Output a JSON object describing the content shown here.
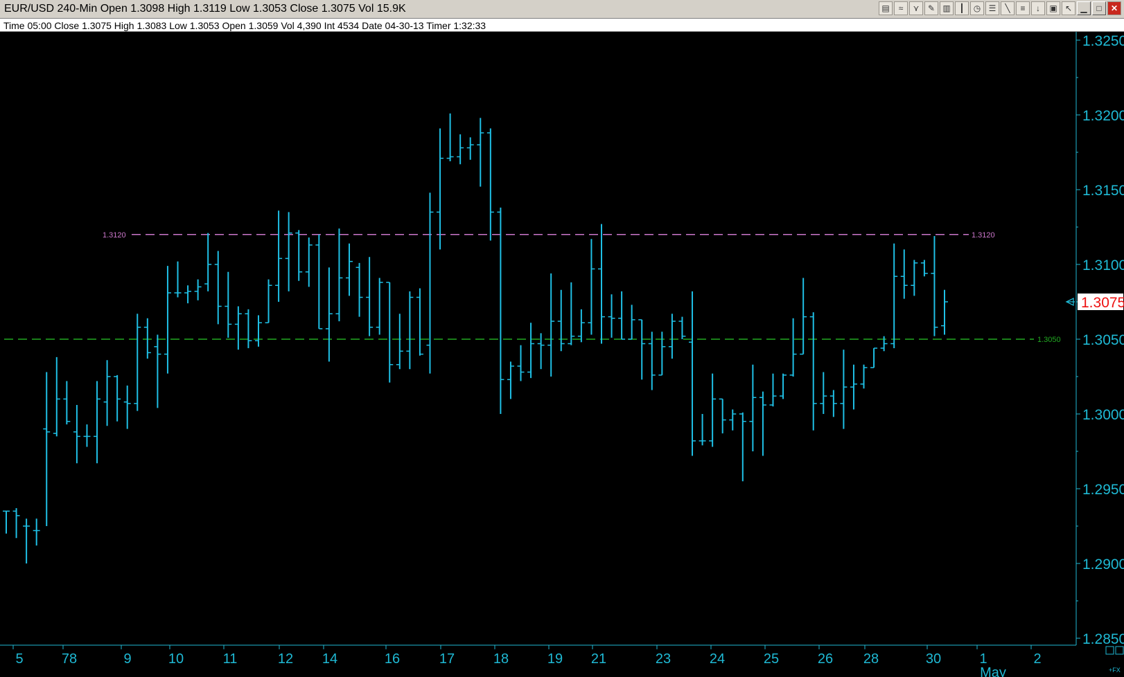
{
  "window": {
    "title": "EUR/USD 240-Min  Open 1.3098  High 1.3119  Low 1.3053  Close 1.3075  Vol 15.9K",
    "toolbar_icons": [
      "bar-chart-icon",
      "moving-average-icon",
      "indicator-icon",
      "pencil-icon",
      "histogram-icon",
      "candlestick-icon",
      "clock-icon",
      "properties-icon",
      "trendline-icon",
      "fibonacci-icon",
      "sell-arrow-icon",
      "delete-icon",
      "pointer-icon"
    ],
    "window_buttons": {
      "minimize": "▁",
      "maximize": "□",
      "close": "✕"
    }
  },
  "info_bar": {
    "text": "Time 05:00   Close 1.3075   High 1.3083   Low 1.3053   Open 1.3059   Vol 4,390   Int 4534   Date 04-30-13   Timer 1:32:33"
  },
  "colors": {
    "background": "#000000",
    "bars": "#1fc0e6",
    "axis": "#1fb9d4",
    "resistance": "#cc77cc",
    "support": "#22aa22",
    "last_price_box": "#ffffff",
    "last_price_text": "#ee1111"
  },
  "chart_data": {
    "type": "ohlc",
    "symbol": "EUR/USD",
    "ylim": [
      1.285,
      1.325
    ],
    "y_ticks": [
      "1.3250",
      "1.3200",
      "1.3150",
      "1.3100",
      "1.3050",
      "1.3000",
      "1.2950",
      "1.2900",
      "1.2850"
    ],
    "x_ticks": [
      "5",
      "78",
      "9",
      "10",
      "11",
      "12",
      "14",
      "16",
      "17",
      "18",
      "19",
      "21",
      "23",
      "24",
      "25",
      "26",
      "28",
      "30",
      "1",
      "2"
    ],
    "x_month_label": "May",
    "horizontal_lines": [
      {
        "name": "resistance",
        "value": 1.312,
        "label": "1.3120"
      },
      {
        "name": "support",
        "value": 1.305,
        "label": "1.3050"
      }
    ],
    "last_price": "1.3075",
    "corner_label": "+FX",
    "bars": [
      [
        1.2935,
        1.2935,
        1.292,
        1.2935
      ],
      [
        1.2935,
        1.2937,
        1.2917,
        1.2932
      ],
      [
        1.2925,
        1.293,
        1.29,
        1.2925
      ],
      [
        1.2922,
        1.293,
        1.2912,
        1.2922
      ],
      [
        1.299,
        1.3028,
        1.2925,
        1.2988
      ],
      [
        1.2987,
        1.3038,
        1.2985,
        1.301
      ],
      [
        1.301,
        1.3022,
        1.2993,
        1.2995
      ],
      [
        1.2988,
        1.3006,
        1.2967,
        1.2985
      ],
      [
        1.2985,
        1.2993,
        1.2978,
        1.2985
      ],
      [
        1.2985,
        1.3022,
        1.2967,
        1.301
      ],
      [
        1.3008,
        1.3036,
        1.2992,
        1.3025
      ],
      [
        1.3025,
        1.3026,
        1.2995,
        1.301
      ],
      [
        1.3008,
        1.3019,
        1.299,
        1.3007
      ],
      [
        1.3007,
        1.3067,
        1.3002,
        1.3058
      ],
      [
        1.3058,
        1.3064,
        1.3037,
        1.3041
      ],
      [
        1.3045,
        1.3053,
        1.3004,
        1.304
      ],
      [
        1.304,
        1.3099,
        1.3027,
        1.3081
      ],
      [
        1.3081,
        1.3102,
        1.3078,
        1.3081
      ],
      [
        1.3081,
        1.3086,
        1.3074,
        1.3082
      ],
      [
        1.3082,
        1.309,
        1.3076,
        1.3085
      ],
      [
        1.3087,
        1.3121,
        1.3082,
        1.31
      ],
      [
        1.31,
        1.3109,
        1.306,
        1.3072
      ],
      [
        1.3072,
        1.3095,
        1.3051,
        1.306
      ],
      [
        1.306,
        1.3072,
        1.3043,
        1.3067
      ],
      [
        1.3067,
        1.307,
        1.3044,
        1.3049
      ],
      [
        1.3049,
        1.3066,
        1.3045,
        1.3061
      ],
      [
        1.3061,
        1.309,
        1.3062,
        1.3086
      ],
      [
        1.3086,
        1.3136,
        1.3075,
        1.3104
      ],
      [
        1.3104,
        1.3135,
        1.3082,
        1.3121
      ],
      [
        1.3121,
        1.3123,
        1.3089,
        1.3095
      ],
      [
        1.3095,
        1.3118,
        1.3085,
        1.3113
      ],
      [
        1.3113,
        1.312,
        1.3058,
        1.3057
      ],
      [
        1.3057,
        1.3098,
        1.3035,
        1.3067
      ],
      [
        1.3067,
        1.3124,
        1.3062,
        1.3091
      ],
      [
        1.3091,
        1.3114,
        1.3079,
        1.3102
      ],
      [
        1.3098,
        1.3101,
        1.3065,
        1.3078
      ],
      [
        1.3078,
        1.3105,
        1.3052,
        1.3058
      ],
      [
        1.3058,
        1.3091,
        1.3053,
        1.3088
      ],
      [
        1.3088,
        1.3072,
        1.3021,
        1.3033
      ],
      [
        1.3033,
        1.3067,
        1.303,
        1.3042
      ],
      [
        1.3042,
        1.3082,
        1.303,
        1.3078
      ],
      [
        1.3078,
        1.3084,
        1.3039,
        1.304
      ],
      [
        1.3046,
        1.3148,
        1.3027,
        1.3135
      ],
      [
        1.3135,
        1.3191,
        1.311,
        1.3171
      ],
      [
        1.3171,
        1.3201,
        1.3169,
        1.3172
      ],
      [
        1.3172,
        1.3187,
        1.3167,
        1.3178
      ],
      [
        1.3178,
        1.3185,
        1.317,
        1.318
      ],
      [
        1.318,
        1.3198,
        1.3152,
        1.3188
      ],
      [
        1.3188,
        1.3191,
        1.3116,
        1.3135
      ],
      [
        1.3135,
        1.3138,
        1.3,
        1.3023
      ],
      [
        1.3023,
        1.3035,
        1.301,
        1.3032
      ],
      [
        1.3032,
        1.3046,
        1.3022,
        1.3028
      ],
      [
        1.3028,
        1.3061,
        1.3024,
        1.3047
      ],
      [
        1.3047,
        1.3054,
        1.303,
        1.3046
      ],
      [
        1.3046,
        1.3094,
        1.3025,
        1.3062
      ],
      [
        1.3062,
        1.3083,
        1.3042,
        1.3047
      ],
      [
        1.3047,
        1.3088,
        1.3046,
        1.3052
      ],
      [
        1.3052,
        1.307,
        1.3048,
        1.3061
      ],
      [
        1.3061,
        1.3117,
        1.3053,
        1.3097
      ],
      [
        1.3097,
        1.3127,
        1.3047,
        1.3065
      ],
      [
        1.3065,
        1.308,
        1.3051,
        1.3064
      ],
      [
        1.3064,
        1.3082,
        1.3054,
        1.305
      ],
      [
        1.305,
        1.3073,
        1.3058,
        1.3063
      ],
      [
        1.3063,
        1.305,
        1.3023,
        1.3047
      ],
      [
        1.3047,
        1.3055,
        1.3016,
        1.3026
      ],
      [
        1.3026,
        1.3055,
        1.304,
        1.3045
      ],
      [
        1.3045,
        1.3067,
        1.3037,
        1.3062
      ],
      [
        1.3062,
        1.3065,
        1.305,
        1.3052
      ],
      [
        1.3048,
        1.3082,
        1.2972,
        1.2982
      ],
      [
        1.2982,
        1.3,
        1.2979,
        1.2982
      ],
      [
        1.2982,
        1.3027,
        1.2978,
        1.301
      ],
      [
        1.301,
        1.3006,
        1.2987,
        1.2996
      ],
      [
        1.2996,
        1.3003,
        1.2989,
        1.3
      ],
      [
        1.3,
        1.3001,
        1.2955,
        1.2995
      ],
      [
        1.2995,
        1.3033,
        1.2975,
        1.3011
      ],
      [
        1.3011,
        1.3015,
        1.2972,
        1.3006
      ],
      [
        1.3006,
        1.3027,
        1.3005,
        1.3012
      ],
      [
        1.3012,
        1.3027,
        1.301,
        1.3026
      ],
      [
        1.3026,
        1.3064,
        1.3025,
        1.304
      ],
      [
        1.304,
        1.3091,
        1.3052,
        1.3065
      ],
      [
        1.3065,
        1.3068,
        1.2989,
        1.3007
      ],
      [
        1.3007,
        1.3028,
        1.3,
        1.3012
      ],
      [
        1.3012,
        1.3016,
        1.2998,
        1.3007
      ],
      [
        1.3007,
        1.3043,
        1.299,
        1.3018
      ],
      [
        1.3018,
        1.3033,
        1.3003,
        1.302
      ],
      [
        1.302,
        1.3033,
        1.3017,
        1.3031
      ],
      [
        1.3031,
        1.3037,
        1.3034,
        1.3044
      ],
      [
        1.3044,
        1.3052,
        1.3042,
        1.3047
      ],
      [
        1.3047,
        1.3114,
        1.3044,
        1.3092
      ],
      [
        1.3092,
        1.311,
        1.3077,
        1.3086
      ],
      [
        1.3086,
        1.3103,
        1.3079,
        1.3101
      ],
      [
        1.3101,
        1.3103,
        1.3092,
        1.3094
      ],
      [
        1.3094,
        1.3119,
        1.3052,
        1.3058
      ],
      [
        1.3059,
        1.3083,
        1.3053,
        1.3075
      ]
    ]
  }
}
